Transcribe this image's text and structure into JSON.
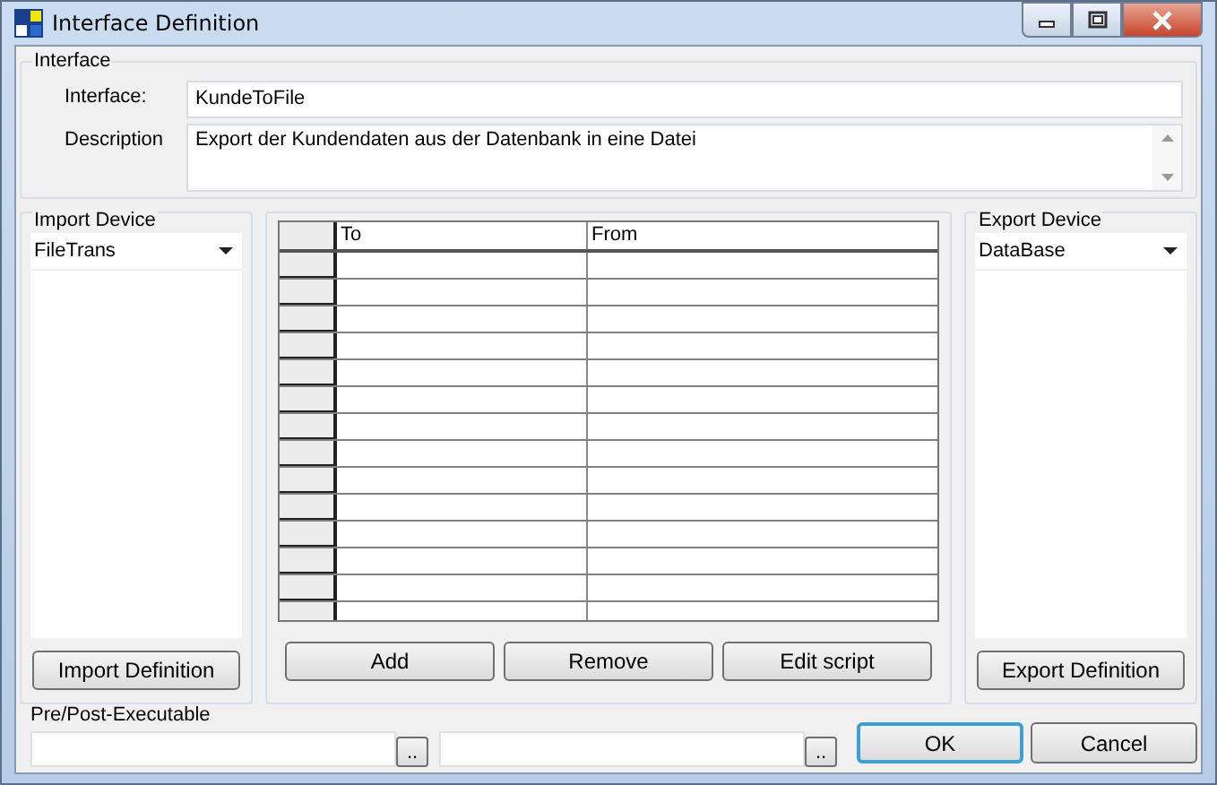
{
  "window": {
    "title": "Interface Definition"
  },
  "interface_group": {
    "title": "Interface",
    "fields": [
      {
        "label": "Interface:",
        "value": "KundeToFile",
        "kind": "single"
      },
      {
        "label": "Description",
        "value": "Export der Kundendaten aus der Datenbank in eine Datei",
        "kind": "multi"
      }
    ]
  },
  "import_device": {
    "title": "Import Device",
    "selected_value": "FileTrans",
    "button": "Import Definition"
  },
  "mapping_table": {
    "columns": [
      "To",
      "From"
    ]
  },
  "table_buttons": [
    "Add",
    "Remove",
    "Edit script"
  ],
  "export_device": {
    "title": "Export Device",
    "selected_value": "DataBase",
    "button": "Export Definition"
  },
  "pre_post_executable": {
    "title": "Pre/Post-Executable",
    "browse_buttons": [
      "..",
      " .."
    ]
  },
  "dialog_buttons": [
    {
      "label": "OK",
      "focused": true
    },
    {
      "label": "Cancel",
      "focused": false
    }
  ]
}
